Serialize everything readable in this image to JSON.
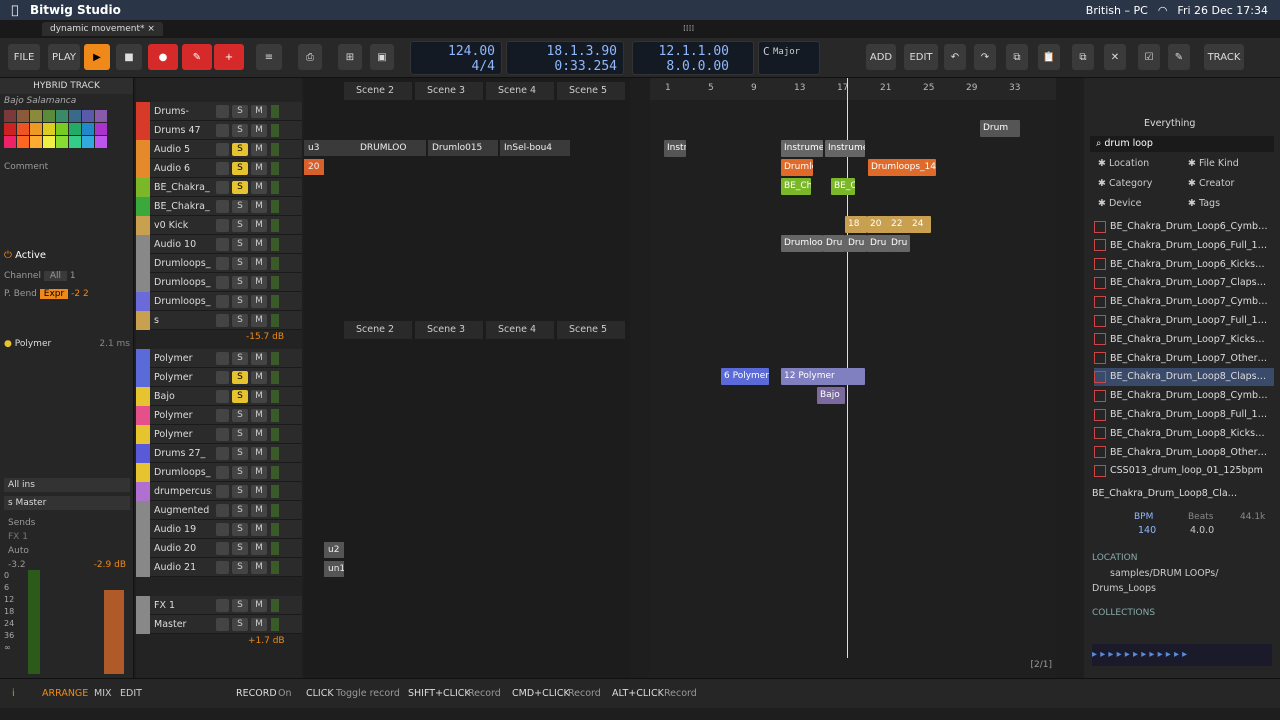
{
  "menubar": {
    "app": "Bitwig Studio",
    "keyboard": "British – PC",
    "datetime": "Fri 26 Dec  17:34"
  },
  "tab": {
    "label": "dynamic movement*"
  },
  "toolbar": {
    "file": "FILE",
    "play": "PLAY",
    "add": "ADD",
    "edit": "EDIT",
    "track": "TRACK",
    "tempo": "124.00",
    "timesig": "4/4",
    "position": "18.1.3.90",
    "time": "0:33.254",
    "loop_start": "12.1.1.00",
    "loop_len": "8.0.0.00",
    "key": "C",
    "scale": "Major"
  },
  "inspector": {
    "title": "HYBRID TRACK",
    "track_name": "Bajo Salamanca",
    "comment": "Comment",
    "active": "Active",
    "channel_label": "Channel",
    "channel_value": "All",
    "channel_num": "1",
    "pbend_label": "P. Bend",
    "pbend_value": "Expr",
    "pbend_min": "-2",
    "pbend_max": "2",
    "device": "Polymer",
    "latency": "2.1 ms",
    "input": "All ins",
    "output": "s Master",
    "sends": "Sends",
    "fx": "FX 1",
    "auto": "Auto",
    "vol1": "-3.2",
    "vol2": "-2.9 dB",
    "scale_marks": [
      "0",
      "6",
      "12",
      "18",
      "24",
      "36",
      "∞"
    ]
  },
  "palette": [
    "#7a3a3a",
    "#8a5a3a",
    "#8a8a3a",
    "#5a8a3a",
    "#3a8a6a",
    "#3a6a8a",
    "#5a5aaa",
    "#8a5aaa",
    "#c22",
    "#e52",
    "#e92",
    "#dc2",
    "#7c2",
    "#2a6",
    "#28c",
    "#a3c",
    "#e26",
    "#f62",
    "#fa3",
    "#ee4",
    "#8d3",
    "#3c8",
    "#3ad",
    "#b5e"
  ],
  "tracks": [
    {
      "name": "Drums-",
      "color": "#d83a2a"
    },
    {
      "name": "Drums 47",
      "color": "#d83a2a"
    },
    {
      "name": "Audio 5",
      "color": "#e58a2a",
      "solo": true
    },
    {
      "name": "Audio 6",
      "color": "#e58a2a",
      "solo": true
    },
    {
      "name": "BE_Chakra_",
      "color": "#7ab82a",
      "solo": true
    },
    {
      "name": "BE_Chakra_",
      "color": "#3aa83a"
    },
    {
      "name": "v0 Kick",
      "color": "#c8a050"
    },
    {
      "name": "Audio 10",
      "color": "#888"
    },
    {
      "name": "Drumloops_",
      "color": "#888"
    },
    {
      "name": "Drumloops_",
      "color": "#888"
    },
    {
      "name": "Drumloops_",
      "color": "#6a6ad8"
    },
    {
      "name": "s",
      "color": "#c8a050"
    },
    {
      "name": "Polymer",
      "color": "#5a6ad8"
    },
    {
      "name": "Polymer",
      "color": "#5a6ad8",
      "solo": true
    },
    {
      "name": "Bajo",
      "color": "#e5c430",
      "solo": true
    },
    {
      "name": "Polymer",
      "color": "#e5508a"
    },
    {
      "name": "Polymer",
      "color": "#e5c430"
    },
    {
      "name": "Drums 27_",
      "color": "#5a5ad8"
    },
    {
      "name": "Drumloops_",
      "color": "#e5c430"
    },
    {
      "name": "drumpercuss",
      "color": "#b070d0"
    },
    {
      "name": "Augmented",
      "color": "#888"
    },
    {
      "name": "Audio 19",
      "color": "#888"
    },
    {
      "name": "Audio 20",
      "color": "#888"
    },
    {
      "name": "Audio 21",
      "color": "#888"
    },
    {
      "name": "FX 1",
      "color": "#888"
    },
    {
      "name": "Master",
      "color": "#888"
    }
  ],
  "track_vol": {
    "group": "-15.7 dB",
    "master": "+1.7 dB"
  },
  "scenes": [
    "Scene 2",
    "Scene 3",
    "Scene 4",
    "Scene 5"
  ],
  "clip_labels": [
    "u3",
    "DRUMLOO",
    "Drumlo015",
    "InSel-bou4",
    "20",
    "u2",
    "un1"
  ],
  "ruler": [
    "1",
    "5",
    "9",
    "13",
    "17",
    "21",
    "25",
    "29",
    "33"
  ],
  "arr_clips": [
    "Drum",
    "Instr",
    "Instrumer",
    "Instrumer",
    "Drumlc",
    "Drumloops_140",
    "BE_Ch",
    "BE_C",
    "18",
    "20",
    "22",
    "24",
    "Drumloop",
    "Dru",
    "Dru",
    "Dru",
    "Dru",
    "6 Polymer",
    "12 Polymer",
    "Bajo"
  ],
  "page_indicator": "[2/1]",
  "browser": {
    "scope": "Everything",
    "search": "drum loop",
    "filters": [
      "Location",
      "File Kind",
      "Category",
      "Creator",
      "Device",
      "Tags"
    ],
    "results": [
      "BE_Chakra_Drum_Loop6_Cymb…",
      "BE_Chakra_Drum_Loop6_Full_1…",
      "BE_Chakra_Drum_Loop6_Kicks…",
      "BE_Chakra_Drum_Loop7_Claps…",
      "BE_Chakra_Drum_Loop7_Cymb…",
      "BE_Chakra_Drum_Loop7_Full_1…",
      "BE_Chakra_Drum_Loop7_Kicks…",
      "BE_Chakra_Drum_Loop7_Other…",
      "BE_Chakra_Drum_Loop8_Claps…",
      "BE_Chakra_Drum_Loop8_Cymb…",
      "BE_Chakra_Drum_Loop8_Full_1…",
      "BE_Chakra_Drum_Loop8_Kicks…",
      "BE_Chakra_Drum_Loop8_Other…",
      "CSS013_drum_loop_01_125bpm"
    ],
    "selected": "BE_Chakra_Drum_Loop8_Cla…",
    "bpm_label": "BPM",
    "bpm": "140",
    "beats_label": "Beats",
    "beats": "4.0.0",
    "rate": "44.1k",
    "location_label": "LOCATION",
    "location": "samples/DRUM LOOPs/",
    "location2": "Drums_Loops",
    "collections_label": "COLLECTIONS"
  },
  "status": {
    "arrange": "ARRANGE",
    "mix": "MIX",
    "edit": "EDIT",
    "record": "RECORD",
    "on": "On",
    "click": "CLICK",
    "toggle": "Toggle record",
    "shift": "SHIFT+CLICK",
    "rec1": "Record",
    "cmd": "CMD+CLICK",
    "rec2": "Record",
    "alt": "ALT+CLICK",
    "rec3": "Record"
  }
}
